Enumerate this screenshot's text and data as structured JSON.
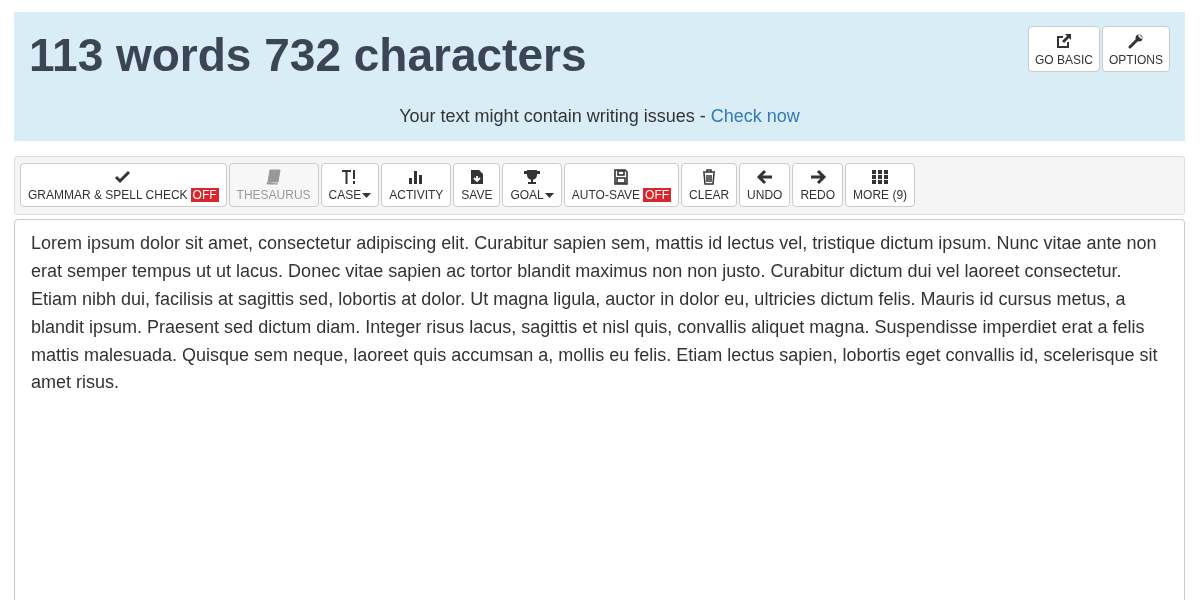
{
  "header": {
    "title": "113 words 732 characters",
    "notice": "Your text might contain writing issues - ",
    "notice_link": "Check now"
  },
  "top_buttons": [
    {
      "label": "GO BASIC"
    },
    {
      "label": "OPTIONS"
    }
  ],
  "toolbar": [
    {
      "label": "GRAMMAR & SPELL CHECK",
      "badge": "OFF",
      "disabled": false,
      "dropdown": false
    },
    {
      "label": "THESAURUS",
      "disabled": true,
      "dropdown": false
    },
    {
      "label": "CASE",
      "disabled": false,
      "dropdown": true
    },
    {
      "label": "ACTIVITY",
      "disabled": false,
      "dropdown": false
    },
    {
      "label": "SAVE",
      "disabled": false,
      "dropdown": false
    },
    {
      "label": "GOAL",
      "disabled": false,
      "dropdown": true
    },
    {
      "label": "AUTO-SAVE",
      "badge": "OFF",
      "disabled": false,
      "dropdown": false
    },
    {
      "label": "CLEAR",
      "disabled": false,
      "dropdown": false
    },
    {
      "label": "UNDO",
      "disabled": false,
      "dropdown": false
    },
    {
      "label": "REDO",
      "disabled": false,
      "dropdown": false
    },
    {
      "label": "MORE (9)",
      "disabled": false,
      "dropdown": false
    }
  ],
  "editor": {
    "value": "Lorem ipsum dolor sit amet, consectetur adipiscing elit. Curabitur sapien sem, mattis id lectus vel, tristique dictum ipsum. Nunc vitae ante non erat semper tempus ut ut lacus. Donec vitae sapien ac tortor blandit maximus non non justo. Curabitur dictum dui vel laoreet consectetur. Etiam nibh dui, facilisis at sagittis sed, lobortis at dolor. Ut magna ligula, auctor in dolor eu, ultricies dictum felis. Mauris id cursus metus, a blandit ipsum. Praesent sed dictum diam. Integer risus lacus, sagittis et nisl quis, convallis aliquet magna. Suspendisse imperdiet erat a felis mattis malesuada. Quisque sem neque, laoreet quis accumsan a, mollis eu felis. Etiam lectus sapien, lobortis eget convallis id, scelerisque sit amet risus."
  }
}
